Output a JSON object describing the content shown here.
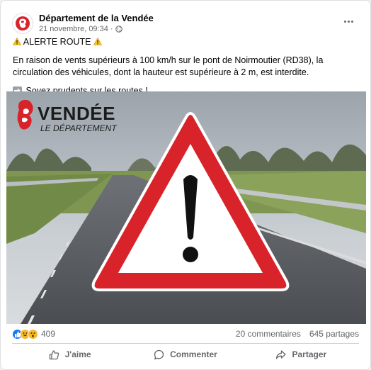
{
  "post": {
    "page_name": "Département de la Vendée",
    "timestamp": "21 novembre, 09:34 ·",
    "visibility_icon": "globe-icon",
    "more_icon": "more-options-icon",
    "alert_title": "ALERTE ROUTE",
    "body": "En raison de vents supérieurs à 100 km/h sur le pont de Noirmoutier (RD38), la circulation des véhicules, dont la hauteur est supérieure à 2 m, est interdite.",
    "footer": "Soyez prudents sur les routes !"
  },
  "image": {
    "logo_title": "VENDÉE",
    "logo_subtitle": "LE DÉPARTEMENT",
    "sign": "warning-triangle-sign",
    "sign_colors": {
      "border": "#d8232a",
      "fill": "#ffffff",
      "mark": "#111111"
    }
  },
  "stats": {
    "reaction_icons": [
      "like-reaction-icon",
      "haha-reaction-icon",
      "wow-reaction-icon"
    ],
    "reaction_count": "409",
    "comments": "20 commentaires",
    "shares": "645 partages"
  },
  "actions": {
    "like": "J'aime",
    "comment": "Commenter",
    "share": "Partager"
  },
  "colors": {
    "brand_red": "#d8232a",
    "like_blue": "#1877f2",
    "muted": "#65676b"
  }
}
